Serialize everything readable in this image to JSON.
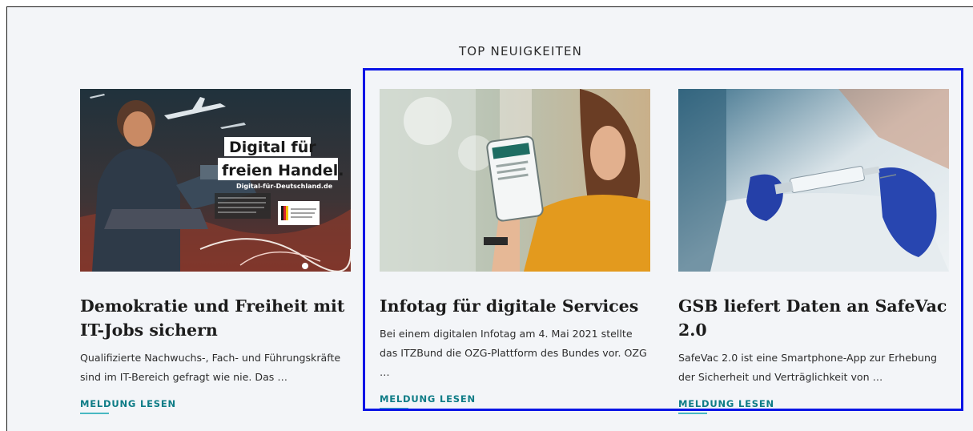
{
  "section": {
    "title": "TOP NEUIGKEITEN"
  },
  "cards": [
    {
      "title": "Demokratie und Freiheit mit IT-Jobs sichern",
      "teaser": "Qualifizierte Nachwuchs-, Fach- und Führungskräfte sind im IT-Bereich gefragt wie nie. Das …",
      "link": "MELDUNG LESEN",
      "image": {
        "headline_line1": "Digital für",
        "headline_line2": "freien Handel.",
        "url_text": "Digital-für-Deutschland.de"
      }
    },
    {
      "title": "Infotag für digitale Services",
      "teaser": "Bei einem digitalen Infotag am 4. Mai 2021 stellte das ITZBund die OZG-Plattform des Bundes vor. OZG …",
      "link": "MELDUNG LESEN"
    },
    {
      "title": "GSB liefert Daten an SafeVac 2.0",
      "teaser": "SafeVac 2.0 ist eine Smartphone-App zur Erhebung der Sicherheit und Verträglichkeit von …",
      "link": "MELDUNG LESEN"
    }
  ],
  "colors": {
    "background": "#f3f5f8",
    "link": "#0e7c86",
    "link_underline": "#48b8c2",
    "highlight": "#0a14e6"
  }
}
